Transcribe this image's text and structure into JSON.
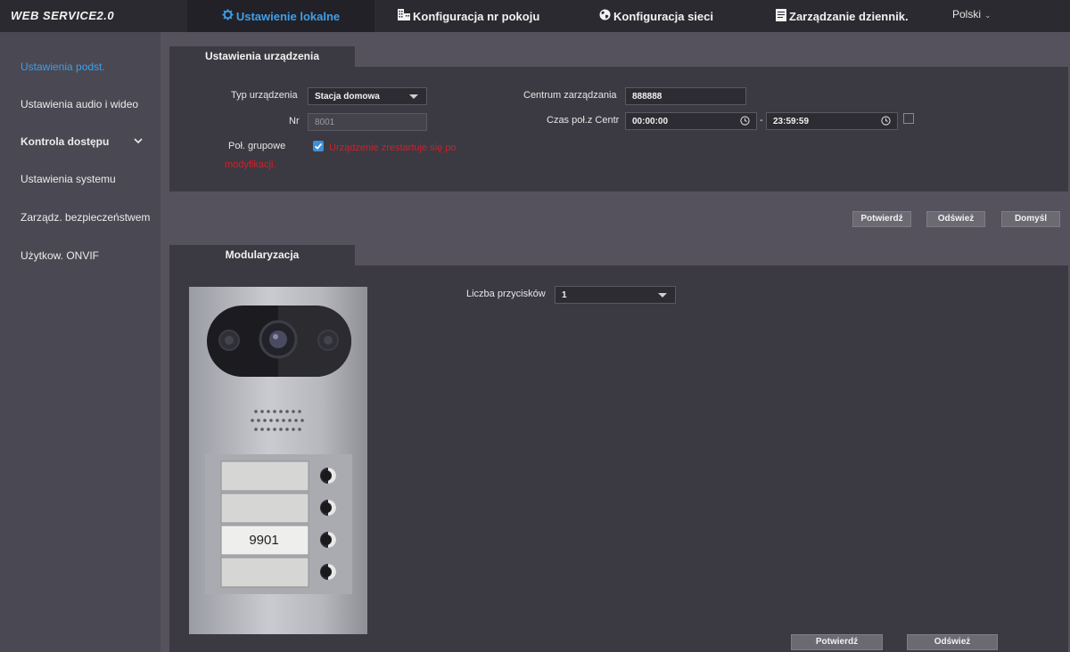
{
  "app": {
    "brand": "WEB SERVICE2.0"
  },
  "topnav": [
    {
      "label": "Ustawienie lokalne",
      "icon": "gear-icon",
      "active": true
    },
    {
      "label": "Konfiguracja nr pokoju",
      "icon": "building-icon",
      "active": false
    },
    {
      "label": "Konfiguracja sieci",
      "icon": "globe-icon",
      "active": false
    },
    {
      "label": "Zarządzanie dziennik.",
      "icon": "log-icon",
      "active": false
    }
  ],
  "language": {
    "value": "Polski"
  },
  "sidebar": [
    {
      "label": "Ustawienia podst.",
      "active": true
    },
    {
      "label": "Ustawienia audio i wideo",
      "active": false
    },
    {
      "label": "Kontrola dostępu",
      "active": false,
      "expandable": true
    },
    {
      "label": "Ustawienia systemu",
      "active": false
    },
    {
      "label": "Zarządz. bezpieczeństwem",
      "active": false
    },
    {
      "label": "Użytkow. ONVIF",
      "active": false
    }
  ],
  "device_settings": {
    "title": "Ustawienia urządzenia",
    "device_type": {
      "label": "Typ urządzenia",
      "value": "Stacja domowa"
    },
    "number": {
      "label": "Nr",
      "value": "8001"
    },
    "group_call": {
      "label": "Poł. grupowe",
      "checked": true,
      "warning": "Urządzenie zrestartuje się po modyfikacji."
    },
    "mgmt_center": {
      "label": "Centrum zarządzania",
      "value": "888888"
    },
    "call_center_time": {
      "label": "Czas poł.z Centr",
      "start": "00:00:00",
      "separator": "-",
      "end": "23:59:59",
      "enabled": false
    },
    "buttons": {
      "confirm": "Potwierdź",
      "refresh": "Odśwież",
      "default": "Domyśl"
    }
  },
  "modularization": {
    "title": "Modularyzacja",
    "buttons_count": {
      "label": "Liczba przycisków",
      "value": "1"
    },
    "device_image": {
      "room_label": "9901",
      "button_rows": 4
    },
    "buttons": {
      "confirm": "Potwierdź",
      "refresh": "Odśwież"
    }
  },
  "colors": {
    "accent": "#3f9fe8",
    "warning": "#d01f2a",
    "topbar": "#2b2a30",
    "panel": "#3b3a42"
  }
}
